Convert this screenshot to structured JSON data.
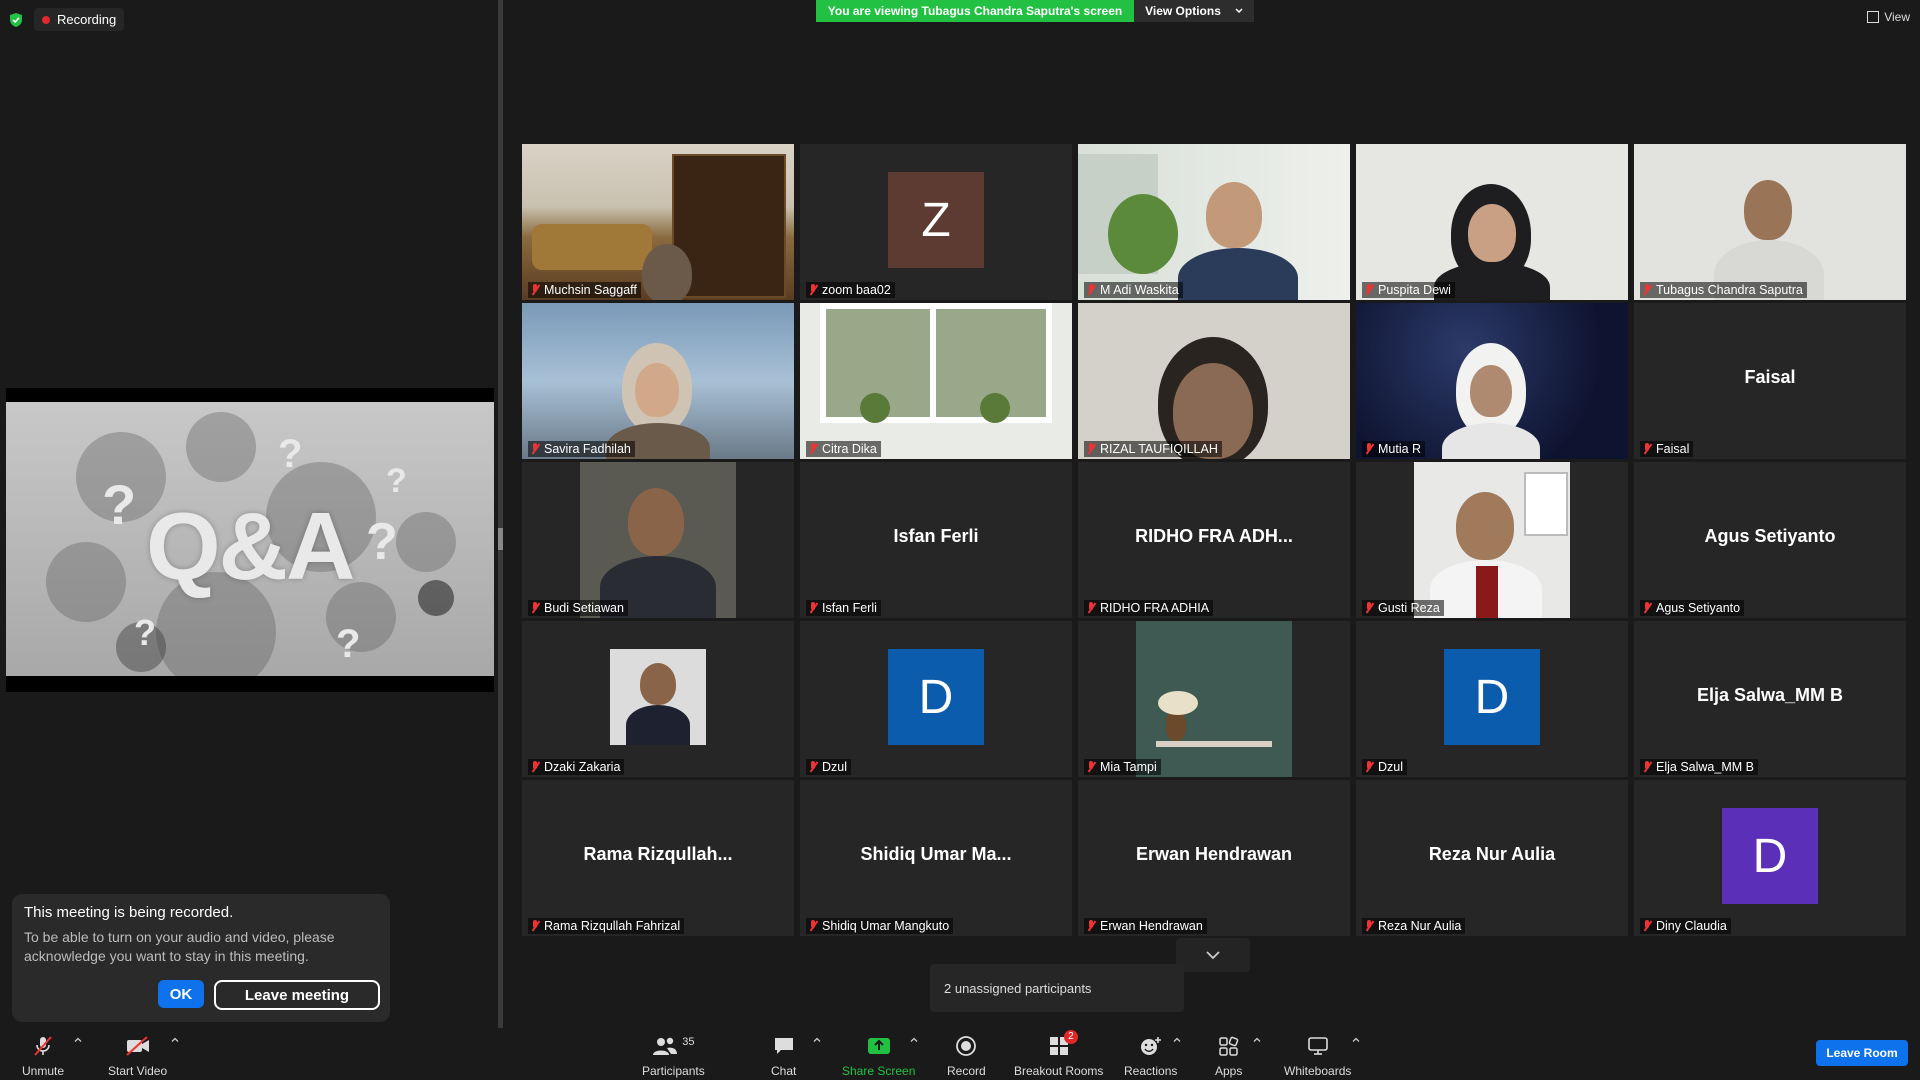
{
  "recording": {
    "label": "Recording"
  },
  "banner": {
    "viewing": "You are viewing Tubagus Chandra Saputra's screen",
    "view_options": "View Options",
    "view": "View"
  },
  "notice": {
    "title": "This meeting is being recorded.",
    "body": "To be able to turn on your audio and video, please acknowledge you want to stay in this meeting.",
    "ok": "OK",
    "leave": "Leave meeting"
  },
  "share": {
    "slide_text": "Q&A"
  },
  "participants": [
    {
      "name": "Muchsin Saggaff",
      "kind": "video",
      "active": true
    },
    {
      "name": "zoom baa02",
      "kind": "avatar",
      "initial": "Z",
      "color": "#5d3a32"
    },
    {
      "name": "M Adi Waskita",
      "kind": "video"
    },
    {
      "name": "Puspita Dewi",
      "kind": "video"
    },
    {
      "name": "Tubagus Chandra Saputra",
      "kind": "video"
    },
    {
      "name": "Savira Fadhilah",
      "kind": "video"
    },
    {
      "name": "Citra Dika",
      "kind": "video"
    },
    {
      "name": "RIZAL TAUFIQILLAH",
      "kind": "video"
    },
    {
      "name": "Mutia R",
      "kind": "video"
    },
    {
      "name": "Faisal",
      "kind": "text",
      "display": "Faisal"
    },
    {
      "name": "Budi Setiawan",
      "kind": "photo"
    },
    {
      "name": "Isfan Ferli",
      "kind": "text",
      "display": "Isfan Ferli"
    },
    {
      "name": "RIDHO FRA ADHIA",
      "kind": "text",
      "display": "RIDHO FRA ADH..."
    },
    {
      "name": "Gusti Reza",
      "kind": "photo"
    },
    {
      "name": "Agus Setiyanto",
      "kind": "text",
      "display": "Agus Setiyanto"
    },
    {
      "name": "Dzaki Zakaria",
      "kind": "photo"
    },
    {
      "name": "Dzul",
      "kind": "avatar",
      "initial": "D",
      "color": "#0b5cad"
    },
    {
      "name": "Mia Tampi",
      "kind": "photo"
    },
    {
      "name": "Dzul",
      "kind": "avatar",
      "initial": "D",
      "color": "#0b5cad"
    },
    {
      "name": "Elja Salwa_MM B",
      "kind": "text",
      "display": "Elja Salwa_MM B"
    },
    {
      "name": "Rama Rizqullah Fahrizal",
      "kind": "text",
      "display": "Rama Rizqullah..."
    },
    {
      "name": "Shidiq Umar Mangkuto",
      "kind": "text",
      "display": "Shidiq Umar Ma..."
    },
    {
      "name": "Erwan Hendrawan",
      "kind": "text",
      "display": "Erwan Hendrawan"
    },
    {
      "name": "Reza Nur Aulia",
      "kind": "text",
      "display": "Reza Nur Aulia"
    },
    {
      "name": "Diny Claudia",
      "kind": "avatar",
      "initial": "D",
      "color": "#5b2fb8"
    }
  ],
  "unassigned": "2 unassigned participants",
  "toolbar": {
    "unmute": "Unmute",
    "start_video": "Start Video",
    "participants": "Participants",
    "participants_count": "35",
    "chat": "Chat",
    "share_screen": "Share Screen",
    "record": "Record",
    "breakout_rooms": "Breakout Rooms",
    "breakout_badge": "2",
    "reactions": "Reactions",
    "apps": "Apps",
    "whiteboards": "Whiteboards",
    "leave_room": "Leave Room"
  },
  "colors": {
    "accent_blue": "#0e72ed",
    "share_green": "#23c143",
    "active_outline": "#e5d84a",
    "muted_red": "#e33"
  }
}
